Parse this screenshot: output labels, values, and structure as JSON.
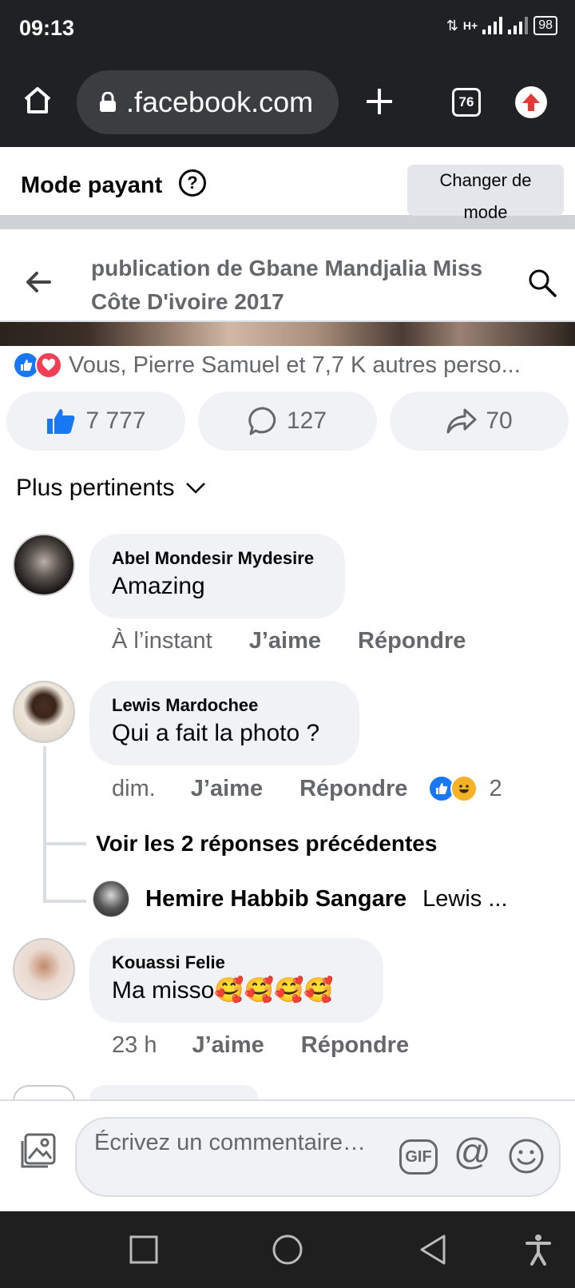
{
  "status": {
    "time": "09:13",
    "network": "H+",
    "battery": "98"
  },
  "browser": {
    "url": ".facebook.com",
    "tab_count": "76"
  },
  "mode": {
    "title": "Mode payant",
    "help": "?",
    "button": "Changer de mode"
  },
  "header": {
    "title": "publication de Gbane Mandjalia Miss Côte D'ivoire 2017"
  },
  "reactions": {
    "summary": "Vous, Pierre Samuel et 7,7 K autres perso..."
  },
  "actions": {
    "likes": "7 777",
    "comments": "127",
    "shares": "70"
  },
  "sort": {
    "label": "Plus pertinents"
  },
  "comments": [
    {
      "author": "Abel Mondesir Mydesire",
      "text": "Amazing",
      "time": "À l’instant",
      "like": "J’aime",
      "reply": "Répondre"
    },
    {
      "author": "Lewis Mardochee",
      "text": "Qui a fait la photo ?",
      "time": "dim.",
      "like": "J’aime",
      "reply": "Répondre",
      "reactions_count": "2",
      "more_replies": "Voir les 2 réponses précédentes",
      "last_reply": {
        "author": "Hemire Habbib Sangare",
        "text": "Lewis ..."
      }
    },
    {
      "author": "Kouassi Felie",
      "text": "Ma misso🥰🥰🥰🥰",
      "time": "23 h",
      "like": "J’aime",
      "reply": "Répondre"
    }
  ],
  "composer": {
    "placeholder": "Écrivez un commentaire…",
    "gif": "GIF",
    "at": "@"
  },
  "colors": {
    "facebook_blue": "#1877f2",
    "love_red": "#f33e58",
    "chrome_dark": "#202124"
  }
}
